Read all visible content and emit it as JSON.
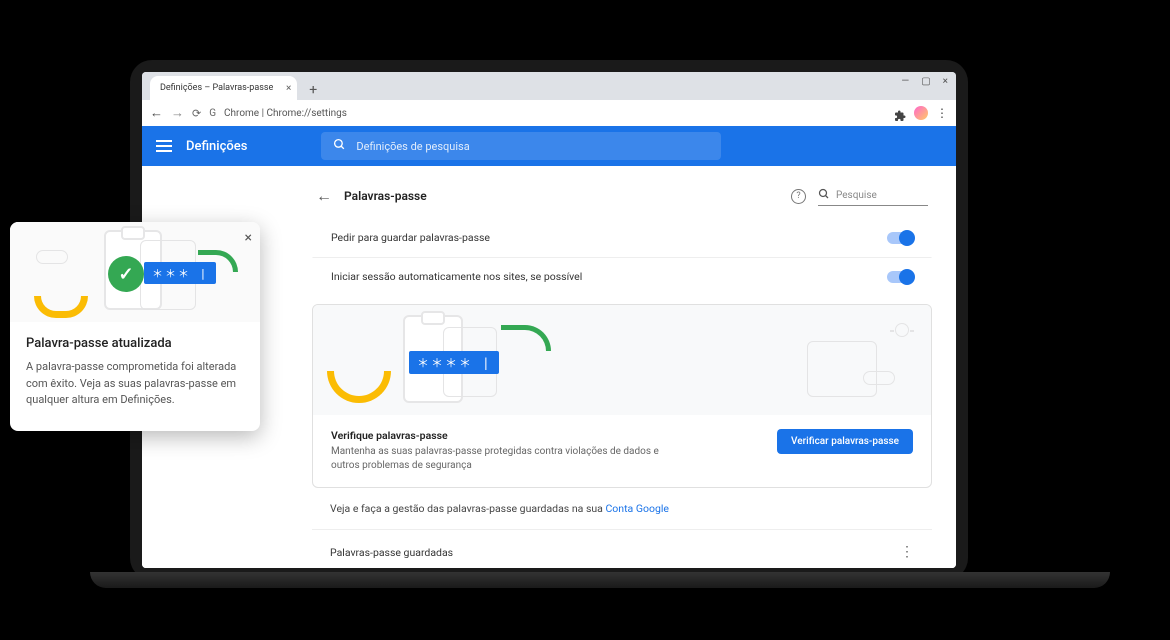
{
  "browser": {
    "tab_title": "Definições – Palavras-passe",
    "url_prefix": "Chrome | ",
    "url": "Chrome://settings"
  },
  "header": {
    "title": "Definições",
    "search_placeholder": "Definições de pesquisa"
  },
  "page": {
    "title": "Palavras-passe",
    "search_placeholder": "Pesquise"
  },
  "settings": {
    "offer_save": "Pedir para guardar palavras-passe",
    "auto_signin": "Iniciar sessão automaticamente nos sites, se possível"
  },
  "check": {
    "heading": "Verifique palavras-passe",
    "description": "Mantenha as suas palavras-passe protegidas contra violações de dados e outros problemas de segurança",
    "button": "Verificar palavras-passe"
  },
  "manage": {
    "prefix": "Veja e faça a gestão das palavras-passe guardadas na sua ",
    "link": "Conta Google"
  },
  "saved": {
    "heading": "Palavras-passe guardadas"
  },
  "popup": {
    "title": "Palavra-passe atualizada",
    "body": "A palavra-passe comprometida foi alterada com êxito. Veja as suas palavras-passe em qualquer altura em Definições."
  },
  "glyphs": {
    "asterisks": "＊＊＊ |",
    "asterisks_long": "＊＊＊＊ |"
  }
}
